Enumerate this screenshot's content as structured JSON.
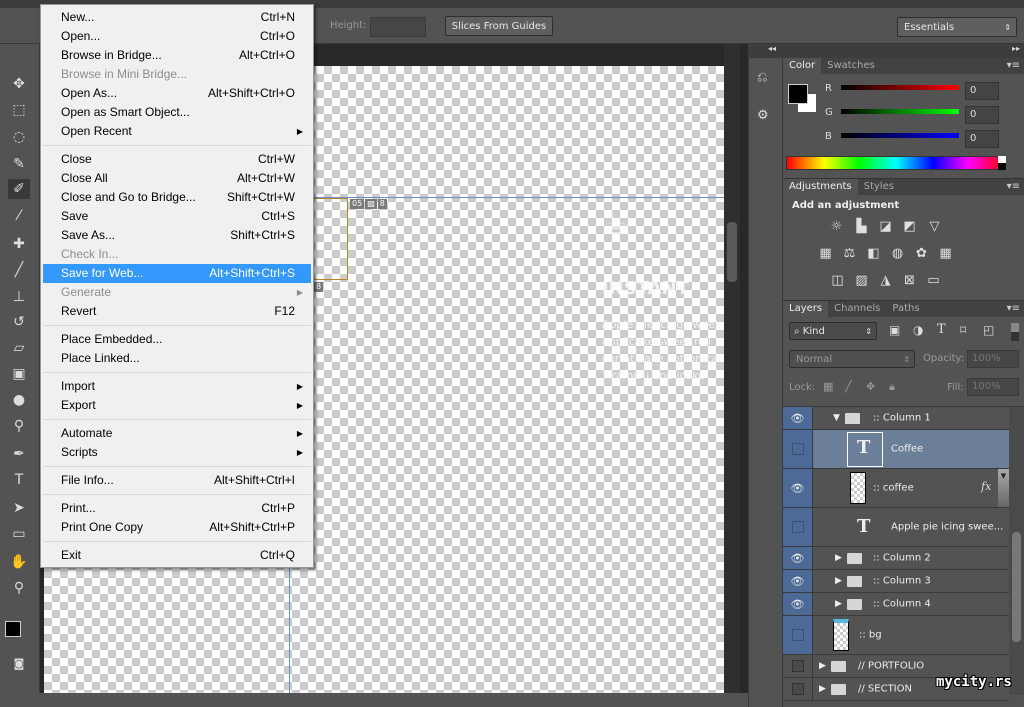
{
  "options_bar": {
    "height_label": "Height:",
    "slices_button": "Slices From Guides",
    "workspace": "Essentials"
  },
  "file_menu": {
    "groups": [
      [
        {
          "label": "New...",
          "shortcut": "Ctrl+N"
        },
        {
          "label": "Open...",
          "shortcut": "Ctrl+O"
        },
        {
          "label": "Browse in Bridge...",
          "shortcut": "Alt+Ctrl+O"
        },
        {
          "label": "Browse in Mini Bridge...",
          "shortcut": "",
          "disabled": true
        },
        {
          "label": "Open As...",
          "shortcut": "Alt+Shift+Ctrl+O"
        },
        {
          "label": "Open as Smart Object...",
          "shortcut": ""
        },
        {
          "label": "Open Recent",
          "shortcut": "",
          "submenu": true
        }
      ],
      [
        {
          "label": "Close",
          "shortcut": "Ctrl+W"
        },
        {
          "label": "Close All",
          "shortcut": "Alt+Ctrl+W"
        },
        {
          "label": "Close and Go to Bridge...",
          "shortcut": "Shift+Ctrl+W"
        },
        {
          "label": "Save",
          "shortcut": "Ctrl+S"
        },
        {
          "label": "Save As...",
          "shortcut": "Shift+Ctrl+S"
        },
        {
          "label": "Check In...",
          "shortcut": "",
          "disabled": true
        },
        {
          "label": "Save for Web...",
          "shortcut": "Alt+Shift+Ctrl+S",
          "highlighted": true
        },
        {
          "label": "Generate",
          "shortcut": "",
          "disabled": true,
          "submenu": true
        },
        {
          "label": "Revert",
          "shortcut": "F12"
        }
      ],
      [
        {
          "label": "Place Embedded...",
          "shortcut": ""
        },
        {
          "label": "Place Linked...",
          "shortcut": ""
        }
      ],
      [
        {
          "label": "Import",
          "shortcut": "",
          "submenu": true
        },
        {
          "label": "Export",
          "shortcut": "",
          "submenu": true
        }
      ],
      [
        {
          "label": "Automate",
          "shortcut": "",
          "submenu": true
        },
        {
          "label": "Scripts",
          "shortcut": "",
          "submenu": true
        }
      ],
      [
        {
          "label": "File Info...",
          "shortcut": "Alt+Shift+Ctrl+I"
        }
      ],
      [
        {
          "label": "Print...",
          "shortcut": "Ctrl+P"
        },
        {
          "label": "Print One Copy",
          "shortcut": "Alt+Shift+Ctrl+P"
        }
      ],
      [
        {
          "label": "Exit",
          "shortcut": "Ctrl+Q"
        }
      ]
    ]
  },
  "canvas": {
    "slice_tag_a": "05",
    "slice_tag_b": "8",
    "slice_tag_c": "8",
    "ghost_title": "INSTANT",
    "ghost_text": [
      "Apple pie icing sweet",
      "applicake sweet roll",
      "carrot cake cotton can",
      "Tiramisu applicake"
    ]
  },
  "color_panel": {
    "tabs": [
      "Color",
      "Swatches"
    ],
    "channels": [
      {
        "label": "R",
        "value": "0",
        "color": "#ff0000"
      },
      {
        "label": "G",
        "value": "0",
        "color": "#00ff00"
      },
      {
        "label": "B",
        "value": "0",
        "color": "#0000ff"
      }
    ]
  },
  "adjustments_panel": {
    "tabs": [
      "Adjustments",
      "Styles"
    ],
    "heading": "Add an adjustment"
  },
  "layers_panel": {
    "tabs": [
      "Layers",
      "Channels",
      "Paths"
    ],
    "filter": "Kind",
    "blend_mode": "Normal",
    "opacity_label": "Opacity:",
    "opacity": "100%",
    "lock_label": "Lock:",
    "fill_label": "Fill:",
    "fill": "100%",
    "layers": [
      {
        "name": ":: Column 1",
        "type": "group",
        "expanded": true,
        "visible": true
      },
      {
        "name": "Coffee",
        "type": "text",
        "visible": false,
        "selected": true
      },
      {
        "name": ":: coffee",
        "type": "pixel",
        "visible": true,
        "fx": "fx"
      },
      {
        "name": "Apple pie icing swee...",
        "type": "text",
        "visible": false
      },
      {
        "name": ":: Column 2",
        "type": "group",
        "visible": true
      },
      {
        "name": ":: Column 3",
        "type": "group",
        "visible": true
      },
      {
        "name": ":: Column 4",
        "type": "group",
        "visible": true
      },
      {
        "name": ":: bg",
        "type": "pixel",
        "visible": false
      },
      {
        "name": "// PORTFOLIO",
        "type": "group",
        "visible": false
      },
      {
        "name": "// SECTION",
        "type": "group",
        "visible": false
      }
    ]
  },
  "watermark": "mycity.rs"
}
